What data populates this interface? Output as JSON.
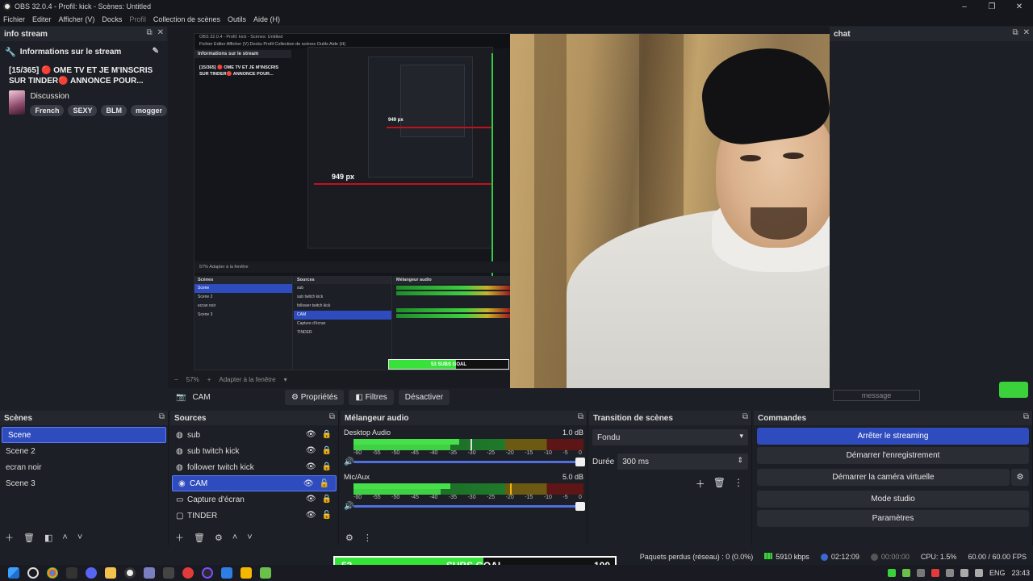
{
  "window": {
    "title": "OBS 32.0.4 - Profil: kick - Scènes: Untitled",
    "controls": [
      "–",
      "❐",
      "✕"
    ]
  },
  "menu": [
    "Fichier",
    "Editer",
    "Afficher (V)",
    "Docks",
    "Profil",
    "Collection de scènes",
    "Outils",
    "Aide (H)"
  ],
  "info_dock": {
    "title": "info stream",
    "subtitle": "Informations sur le stream",
    "stream_title": "[15/365] 🔴 OME TV ET JE M'INSCRIS SUR TINDER🔴 ANNONCE POUR...",
    "category": "Discussion",
    "tags": [
      "French",
      "SEXY",
      "BLM",
      "mogger"
    ]
  },
  "preview": {
    "measure_label": "949 px",
    "measure_label_small": "949 px",
    "nested_title": "OBS 32.0.4 - Profil: kick - Scènes: Untitled",
    "nested_menu": "Fichier   Editer   Afficher (V)   Docks   Profil   Collection de scènes   Outils   Aide (H)",
    "nested_info_title": "Informations sur le stream",
    "nested_stream_title": "[15/365] 🔴 OME TV ET JE M'INSCRIS SUR TINDER🔴 ANNONCE POUR...",
    "nested_zoom": "57%   Adapter à la fenêtre",
    "nested_goal": "53          SUBS GOAL",
    "nested_scenes": [
      "Scene",
      "Scene 2",
      "ecran noir",
      "Scene 3"
    ],
    "nested_sources": [
      "sub",
      "sub twitch kick",
      "follower twitch kick",
      "CAM",
      "Capture d'écran",
      "TINDER"
    ]
  },
  "zoom_bar": {
    "zoom": "57%",
    "fit_label": "Adapter à la fenêtre"
  },
  "source_toolbar": {
    "selected_source": "CAM",
    "properties": "Propriétés",
    "filters": "Filtres",
    "deactivate": "Désactiver"
  },
  "chat": {
    "title": "chat",
    "message_placeholder": "message"
  },
  "scenes": {
    "title": "Scènes",
    "items": [
      "Scene",
      "Scene 2",
      "ecran noir",
      "Scene 3"
    ],
    "selected_index": 0
  },
  "sources": {
    "title": "Sources",
    "items": [
      {
        "name": "sub",
        "icon": "globe-icon"
      },
      {
        "name": "sub twitch kick",
        "icon": "globe-icon"
      },
      {
        "name": "follower twitch kick",
        "icon": "globe-icon"
      },
      {
        "name": "CAM",
        "icon": "camera-icon"
      },
      {
        "name": "Capture d'écran",
        "icon": "monitor-icon"
      },
      {
        "name": "TINDER",
        "icon": "window-icon"
      }
    ],
    "selected_index": 3
  },
  "mixer": {
    "title": "Mélangeur audio",
    "channels": [
      {
        "name": "Desktop Audio",
        "db": "1.0 dB",
        "level": 0.46,
        "level2": 0.42,
        "peak": 0.51
      },
      {
        "name": "Mic/Aux",
        "db": "5.0 dB",
        "level": 0.42,
        "level2": 0.38,
        "peak": 0.68
      }
    ],
    "scale": [
      "-60",
      "-55",
      "-50",
      "-45",
      "-40",
      "-35",
      "-30",
      "-25",
      "-20",
      "-15",
      "-10",
      "-5",
      "0"
    ]
  },
  "transitions": {
    "title": "Transition de scènes",
    "type": "Fondu",
    "duration_label": "Durée",
    "duration": "300 ms"
  },
  "commands": {
    "title": "Commandes",
    "buttons": [
      "Arrêter le streaming",
      "Démarrer l'enregistrement",
      "Démarrer la caméra virtuelle",
      "Mode studio",
      "Paramètres"
    ]
  },
  "status": {
    "dropped": "Paquets perdus (réseau) : 0 (0.0%)",
    "bitrate": "5910 kbps",
    "stream_time": "02:12:09",
    "rec_time": "00:00:00",
    "cpu": "CPU: 1.5%",
    "fps": "60.00 / 60.00 FPS"
  },
  "goal": {
    "current": "53",
    "label": "SUBS GOAL",
    "target": "100",
    "progress": 0.53
  },
  "taskbar": {
    "lang": "ENG",
    "clock": "23:43"
  },
  "colors": {
    "accent": "#2f4cbf",
    "green": "#34e437",
    "red_guide": "#c1121c"
  }
}
